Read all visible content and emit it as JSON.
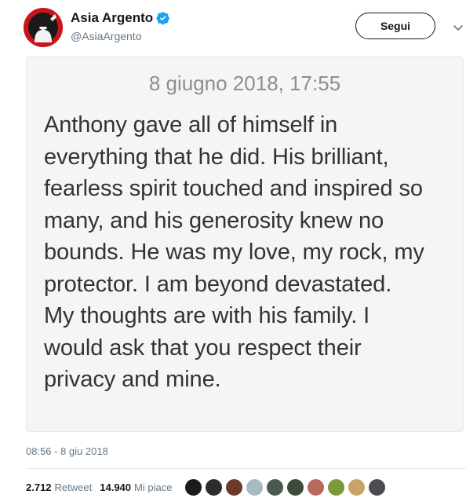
{
  "user": {
    "name": "Asia Argento",
    "handle": "@AsiaArgento",
    "verified": true
  },
  "follow_button": {
    "label": "Segui"
  },
  "note": {
    "date": "8 giugno 2018, 17:55",
    "lines": [
      "Anthony gave all of himself in",
      "everything that he did. His brilliant,",
      "fearless spirit touched and inspired so",
      "many, and his generosity knew no",
      "bounds. He was my love, my rock, my",
      "protector. I am beyond devastated.",
      "My thoughts are with his family. I",
      "would ask that you respect their",
      "privacy and mine."
    ]
  },
  "tweet": {
    "timestamp": "08:56 - 8 giu 2018",
    "retweets": {
      "count": "2.712",
      "label": "Retweet"
    },
    "likes": {
      "count": "14.940",
      "label": "Mi piace"
    }
  },
  "likers": [
    {
      "name": "liker-1",
      "color": "#1b1b1b"
    },
    {
      "name": "liker-2",
      "color": "#2d2d2d"
    },
    {
      "name": "liker-3",
      "color": "#6b3a2a"
    },
    {
      "name": "liker-4",
      "color": "#aab8c2"
    },
    {
      "name": "liker-5",
      "color": "#4a5a4f"
    },
    {
      "name": "liker-6",
      "color": "#3e4a3a"
    },
    {
      "name": "liker-7",
      "color": "#b56a5c"
    },
    {
      "name": "liker-8",
      "color": "#7b9a3a"
    },
    {
      "name": "liker-9",
      "color": "#c9a26a"
    },
    {
      "name": "liker-10",
      "color": "#4b4b52"
    }
  ],
  "colors": {
    "verified": "#1da1f2",
    "avatar_bg": "#c9141b",
    "note_bg": "#f5f5f3"
  }
}
